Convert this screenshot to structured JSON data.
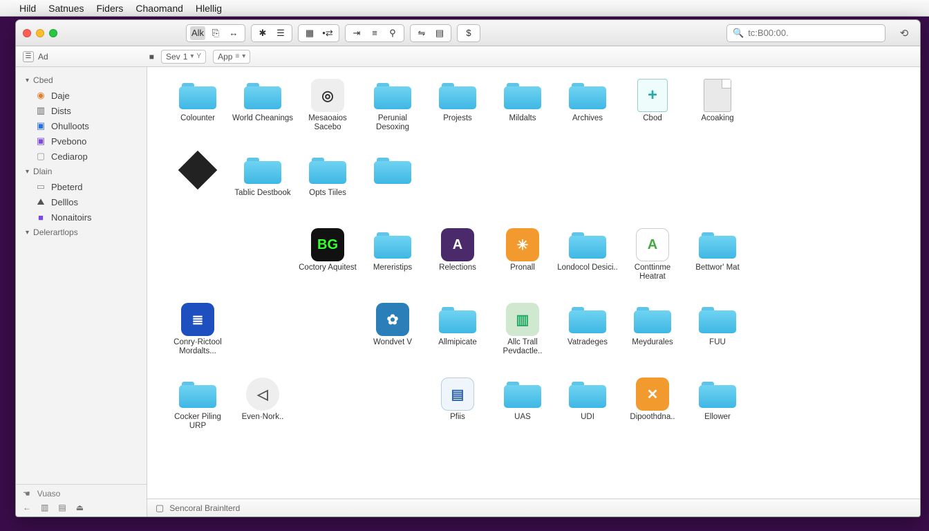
{
  "menubar": {
    "items": [
      "Hild",
      "Satnues",
      "Fiders",
      "Chaomand",
      "Hlellig"
    ]
  },
  "toolbar": {
    "group1": [
      "Alk",
      "⎘",
      "↔"
    ],
    "group2": [
      "✱",
      "☰"
    ],
    "group3": [
      "▦",
      "•⇄"
    ],
    "group4": [
      "⇥",
      "≡",
      "⚲"
    ],
    "group5": [
      "⇋",
      "▤"
    ],
    "group6": [
      "$"
    ]
  },
  "search": {
    "placeholder": "tc:B00:00."
  },
  "sortbar": {
    "left_label": "Ad",
    "sort": "Sev",
    "sort_num": "1",
    "arrange": "App"
  },
  "sidebar": {
    "sections": [
      {
        "title": "Cbed",
        "items": [
          {
            "icon": "◉",
            "color": "#e27d2a",
            "label": "Daje"
          },
          {
            "icon": "▥",
            "color": "#666",
            "label": "Dists"
          },
          {
            "icon": "▣",
            "color": "#2d6cdf",
            "label": "Ohulloots"
          },
          {
            "icon": "▣",
            "color": "#7a4ad8",
            "label": "Pvebono"
          },
          {
            "icon": "▢",
            "color": "#999",
            "label": "Cediarop"
          }
        ]
      },
      {
        "title": "Dlain",
        "items": [
          {
            "icon": "▭",
            "color": "#888",
            "label": "Pbeterd"
          },
          {
            "icon": "⛰",
            "color": "#555",
            "label": "Delllos"
          },
          {
            "icon": "■",
            "color": "#7a4ad8",
            "label": "Nonaitoirs"
          }
        ]
      },
      {
        "title": "Delerartlops",
        "items": []
      }
    ],
    "footer_label": "Vuaso"
  },
  "items": [
    {
      "type": "folder",
      "label": "Colounter"
    },
    {
      "type": "folder",
      "label": "World Cheanings"
    },
    {
      "type": "app",
      "bg": "#eee",
      "fg": "#333",
      "txt": "◎",
      "label": "Mesaoaios Sacebo"
    },
    {
      "type": "folder",
      "label": "Perunial Desoxing"
    },
    {
      "type": "folder",
      "label": "Projests"
    },
    {
      "type": "folder",
      "label": "Mildalts"
    },
    {
      "type": "folder",
      "label": "Archives"
    },
    {
      "type": "add",
      "label": "Cbod"
    },
    {
      "type": "doc",
      "label": "Acoaking"
    },
    {
      "type": "diamond",
      "label": ""
    },
    {
      "type": "folder",
      "label": "Tablic Destbook"
    },
    {
      "type": "folder",
      "label": "Opts Tiiles"
    },
    {
      "type": "folder",
      "label": ""
    },
    {
      "type": "blank"
    },
    {
      "type": "blank"
    },
    {
      "type": "blank"
    },
    {
      "type": "blank"
    },
    {
      "type": "blank"
    },
    {
      "type": "blank"
    },
    {
      "type": "blank"
    },
    {
      "type": "app",
      "bg": "#111",
      "fg": "#3f3",
      "txt": "BG",
      "label": "Coctory Aquitest"
    },
    {
      "type": "folder",
      "label": "Mereristips"
    },
    {
      "type": "app",
      "bg": "#4a2a6a",
      "fg": "#fff",
      "txt": "A",
      "label": "Relections"
    },
    {
      "type": "app",
      "bg": "#f29a2e",
      "fg": "#fff",
      "txt": "✳",
      "label": "Pronall"
    },
    {
      "type": "folder",
      "label": "Londocol Desici.."
    },
    {
      "type": "app",
      "bg": "#fff",
      "fg": "#4a4",
      "txt": "A",
      "label": "Conttinme Heatrat",
      "border": "1px solid #ccc"
    },
    {
      "type": "folder",
      "label": "Bettwor' Mat"
    },
    {
      "type": "app",
      "bg": "#1e4fbf",
      "fg": "#fff",
      "txt": "≣",
      "label": "Conry·Rictool Mordalts..."
    },
    {
      "type": "blank"
    },
    {
      "type": "blank"
    },
    {
      "type": "app",
      "bg": "#2b7fb8",
      "fg": "#fff",
      "txt": "✿",
      "label": "Wondvet V"
    },
    {
      "type": "folder",
      "label": "Allmipicate"
    },
    {
      "type": "app",
      "bg": "#cfe8cf",
      "fg": "#2a6",
      "txt": "▥",
      "label": "Allc Trall Pevdactle.."
    },
    {
      "type": "folder",
      "label": "Vatradeges"
    },
    {
      "type": "folder",
      "label": "Meydurales"
    },
    {
      "type": "folder",
      "label": "FUU"
    },
    {
      "type": "folder",
      "label": "Cocker Piling URP"
    },
    {
      "type": "app",
      "bg": "#eee",
      "fg": "#555",
      "txt": "◁",
      "label": "Even·Nork..",
      "round": "50%"
    },
    {
      "type": "blank"
    },
    {
      "type": "blank"
    },
    {
      "type": "app",
      "bg": "#eef6fb",
      "fg": "#36a",
      "txt": "▤",
      "label": "Pfiis",
      "border": "1px solid #bcd"
    },
    {
      "type": "folder",
      "label": "UAS"
    },
    {
      "type": "folder",
      "label": "UDI"
    },
    {
      "type": "app",
      "bg": "#f29a2e",
      "fg": "#fff",
      "txt": "✕",
      "label": "Dipoothdna.."
    },
    {
      "type": "folder",
      "label": "Ellower"
    },
    {
      "type": "blank"
    },
    {
      "type": "blank"
    },
    {
      "type": "blank"
    },
    {
      "type": "blank"
    },
    {
      "type": "blank"
    }
  ],
  "status": {
    "text": "Sencoral Brainlterd"
  }
}
